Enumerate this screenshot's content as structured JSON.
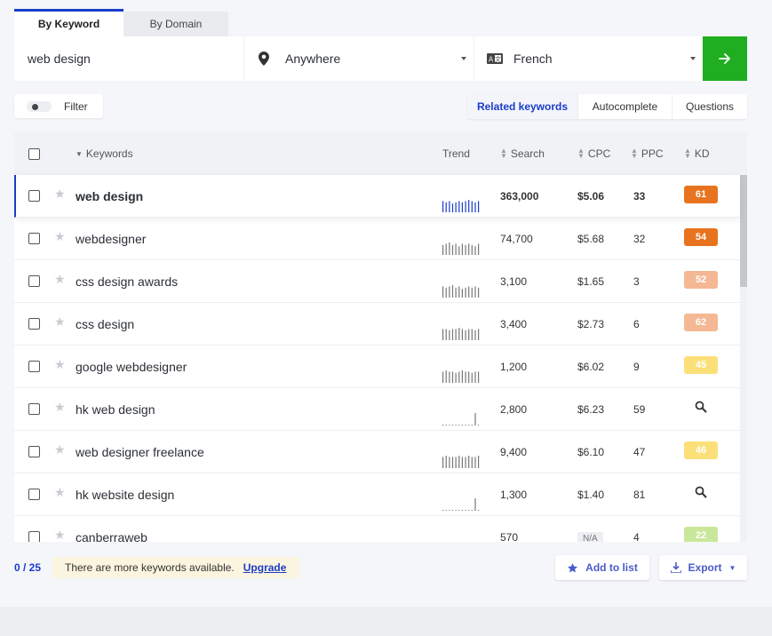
{
  "tabs": [
    {
      "label": "By Keyword",
      "active": true
    },
    {
      "label": "By Domain",
      "active": false
    }
  ],
  "search": {
    "keyword_value": "web design",
    "location_label": "Anywhere",
    "location_icon": "map-pin-icon",
    "language_label": "French",
    "language_icon": "translate-icon",
    "go_icon": "arrow-right-icon",
    "accent": "#1fae1f"
  },
  "filter": {
    "label": "Filter",
    "enabled": false
  },
  "mode_tabs": [
    {
      "label": "Related keywords",
      "active": true
    },
    {
      "label": "Autocomplete",
      "active": false
    },
    {
      "label": "Questions",
      "active": false
    }
  ],
  "columns": {
    "keywords": "Keywords",
    "trend": "Trend",
    "search": "Search",
    "cpc": "CPC",
    "ppc": "PPC",
    "kd": "KD"
  },
  "rows": [
    {
      "keyword": "web design",
      "search": "363,000",
      "cpc": "$5.06",
      "ppc": "33",
      "kd": "61",
      "kd_color": "#e8731f",
      "selected": true,
      "trend": [
        0.9,
        0.8,
        0.9,
        0.7,
        0.8,
        0.9,
        0.8,
        0.9,
        1,
        0.9,
        0.8,
        0.9
      ],
      "trend_color": "#1a3cc8"
    },
    {
      "keyword": "webdesigner",
      "search": "74,700",
      "cpc": "$5.68",
      "ppc": "32",
      "kd": "54",
      "kd_color": "#e8731f",
      "selected": false,
      "trend": [
        0.8,
        0.9,
        1,
        0.8,
        0.9,
        0.7,
        0.9,
        0.8,
        0.9,
        0.8,
        0.7,
        0.9
      ],
      "trend_color": "#777"
    },
    {
      "keyword": "css design awards",
      "search": "3,100",
      "cpc": "$1.65",
      "ppc": "3",
      "kd": "52",
      "kd_color": "#f4b894",
      "selected": false,
      "trend": [
        0.9,
        0.8,
        0.9,
        1,
        0.8,
        0.9,
        0.7,
        0.8,
        0.9,
        0.8,
        0.9,
        0.8
      ],
      "trend_color": "#777"
    },
    {
      "keyword": "css design",
      "search": "3,400",
      "cpc": "$2.73",
      "ppc": "6",
      "kd": "62",
      "kd_color": "#f4b894",
      "selected": false,
      "trend": [
        0.9,
        0.9,
        0.8,
        0.9,
        0.9,
        1,
        0.9,
        0.8,
        0.9,
        0.9,
        0.8,
        0.9
      ],
      "trend_color": "#777"
    },
    {
      "keyword": "google webdesigner",
      "search": "1,200",
      "cpc": "$6.02",
      "ppc": "9",
      "kd": "45",
      "kd_color": "#fbe07a",
      "selected": false,
      "trend": [
        0.9,
        1,
        0.9,
        0.9,
        0.8,
        0.9,
        1,
        0.9,
        0.9,
        0.8,
        0.9,
        0.9
      ],
      "trend_color": "#777"
    },
    {
      "keyword": "hk web design",
      "search": "2,800",
      "cpc": "$6.23",
      "ppc": "59",
      "kd": "",
      "kd_color": "",
      "selected": false,
      "trend": [
        0.05,
        0.05,
        0.05,
        0.05,
        0.05,
        0.05,
        0.05,
        0.05,
        0.05,
        0.05,
        1,
        0.05
      ],
      "trend_color": "#777"
    },
    {
      "keyword": "web designer freelance",
      "search": "9,400",
      "cpc": "$6.10",
      "ppc": "47",
      "kd": "46",
      "kd_color": "#fbe07a",
      "selected": false,
      "trend": [
        0.9,
        1,
        0.9,
        0.9,
        0.9,
        1,
        0.9,
        0.9,
        1,
        0.9,
        0.9,
        1
      ],
      "trend_color": "#777"
    },
    {
      "keyword": "hk website design",
      "search": "1,300",
      "cpc": "$1.40",
      "ppc": "81",
      "kd": "",
      "kd_color": "",
      "selected": false,
      "trend": [
        0.05,
        0.05,
        0.05,
        0.05,
        0.05,
        0.05,
        0.05,
        0.05,
        0.05,
        0.05,
        1,
        0.05
      ],
      "trend_color": "#777"
    },
    {
      "keyword": "canberraweb",
      "search": "570",
      "cpc": "N/A",
      "ppc": "4",
      "kd": "22",
      "kd_color": "#c9e79a",
      "selected": false,
      "trend": [],
      "trend_color": "#777"
    }
  ],
  "footer": {
    "counter": "0 / 25",
    "notice": "There are more keywords available.",
    "upgrade": "Upgrade",
    "add_to_list": "Add to list",
    "export": "Export"
  }
}
